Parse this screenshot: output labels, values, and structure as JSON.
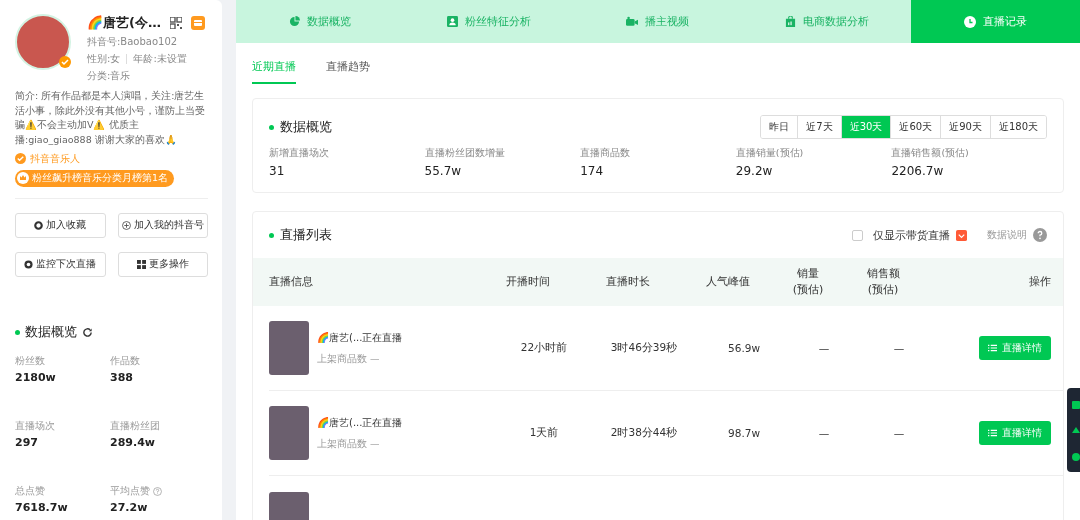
{
  "profile": {
    "name": "🌈唐艺(今…",
    "douyin_id": "抖音号:Baobao102",
    "gender": "性别:女",
    "age": "年龄:未设置",
    "category": "分类:音乐",
    "bio": "简介: 所有作品都是本人演唱，关注:唐艺生活小事，除此外没有其他小号，谨防上当受骗⚠️不会主动加V⚠️ 优质主播:giao_giao888 谢谢大家的喜欢🙏",
    "verified_label": "抖音音乐人",
    "rank_badge": "粉丝飙升榜音乐分类月榜第1名"
  },
  "actions": [
    {
      "kind": "collect",
      "label": "加入收藏"
    },
    {
      "kind": "add",
      "label": "加入我的抖音号"
    },
    {
      "kind": "monitor",
      "label": "监控下次直播"
    },
    {
      "kind": "more",
      "label": "更多操作"
    }
  ],
  "overview": {
    "title": "数据概览",
    "stats": [
      {
        "label": "粉丝数",
        "value": "2180w",
        "help": false
      },
      {
        "label": "作品数",
        "value": "388",
        "help": false
      },
      {
        "label": "直播场次",
        "value": "297",
        "help": false
      },
      {
        "label": "直播粉丝团",
        "value": "289.4w",
        "help": false
      },
      {
        "label": "总点赞",
        "value": "7618.7w",
        "help": false
      },
      {
        "label": "平均点赞",
        "value": "27.2w",
        "help": true
      }
    ]
  },
  "tabs": [
    {
      "kind": "pie",
      "label": "数据概览",
      "selected": false
    },
    {
      "kind": "person",
      "label": "粉丝特征分析",
      "selected": false
    },
    {
      "kind": "video",
      "label": "播主视频",
      "selected": false
    },
    {
      "kind": "bag",
      "label": "电商数据分析",
      "selected": false
    },
    {
      "kind": "clock",
      "label": "直播记录",
      "selected": true
    }
  ],
  "subtabs": [
    {
      "label": "近期直播",
      "selected": true
    },
    {
      "label": "直播趋势",
      "selected": false
    }
  ],
  "summary": {
    "title": "数据概览",
    "ranges": [
      {
        "label": "昨日",
        "selected": false
      },
      {
        "label": "近7天",
        "selected": false
      },
      {
        "label": "近30天",
        "selected": true
      },
      {
        "label": "近60天",
        "selected": false
      },
      {
        "label": "近90天",
        "selected": false
      },
      {
        "label": "近180天",
        "selected": false
      }
    ],
    "stats": [
      {
        "label": "新增直播场次",
        "value": "31"
      },
      {
        "label": "直播粉丝团数增量",
        "value": "55.7w"
      },
      {
        "label": "直播商品数",
        "value": "174"
      },
      {
        "label": "直播销量(预估)",
        "value": "29.2w"
      },
      {
        "label": "直播销售额(预估)",
        "value": "2206.7w"
      }
    ]
  },
  "live_list": {
    "title": "直播列表",
    "filter": {
      "label": "仅显示带货直播",
      "checked": false
    },
    "help": "数据说明",
    "columns": [
      {
        "label": "直播信息"
      },
      {
        "label": "开播时间"
      },
      {
        "label": "直播时长"
      },
      {
        "label": "人气峰值"
      },
      {
        "label": "销量",
        "note": "(预估)"
      },
      {
        "label": "销售额",
        "note": "(预估)"
      },
      {
        "label": "操作"
      }
    ],
    "rows": [
      {
        "name": "🌈唐艺(...正在直播",
        "products": "上架商品数 —",
        "start": "22小时前",
        "duration": "3时46分39秒",
        "peak": "56.9w",
        "sales": "—",
        "revenue": "—",
        "action": "直播详情"
      },
      {
        "name": "🌈唐艺(...正在直播",
        "products": "上架商品数 —",
        "start": "1天前",
        "duration": "2时38分44秒",
        "peak": "98.7w",
        "sales": "—",
        "revenue": "—",
        "action": "直播详情"
      }
    ]
  }
}
